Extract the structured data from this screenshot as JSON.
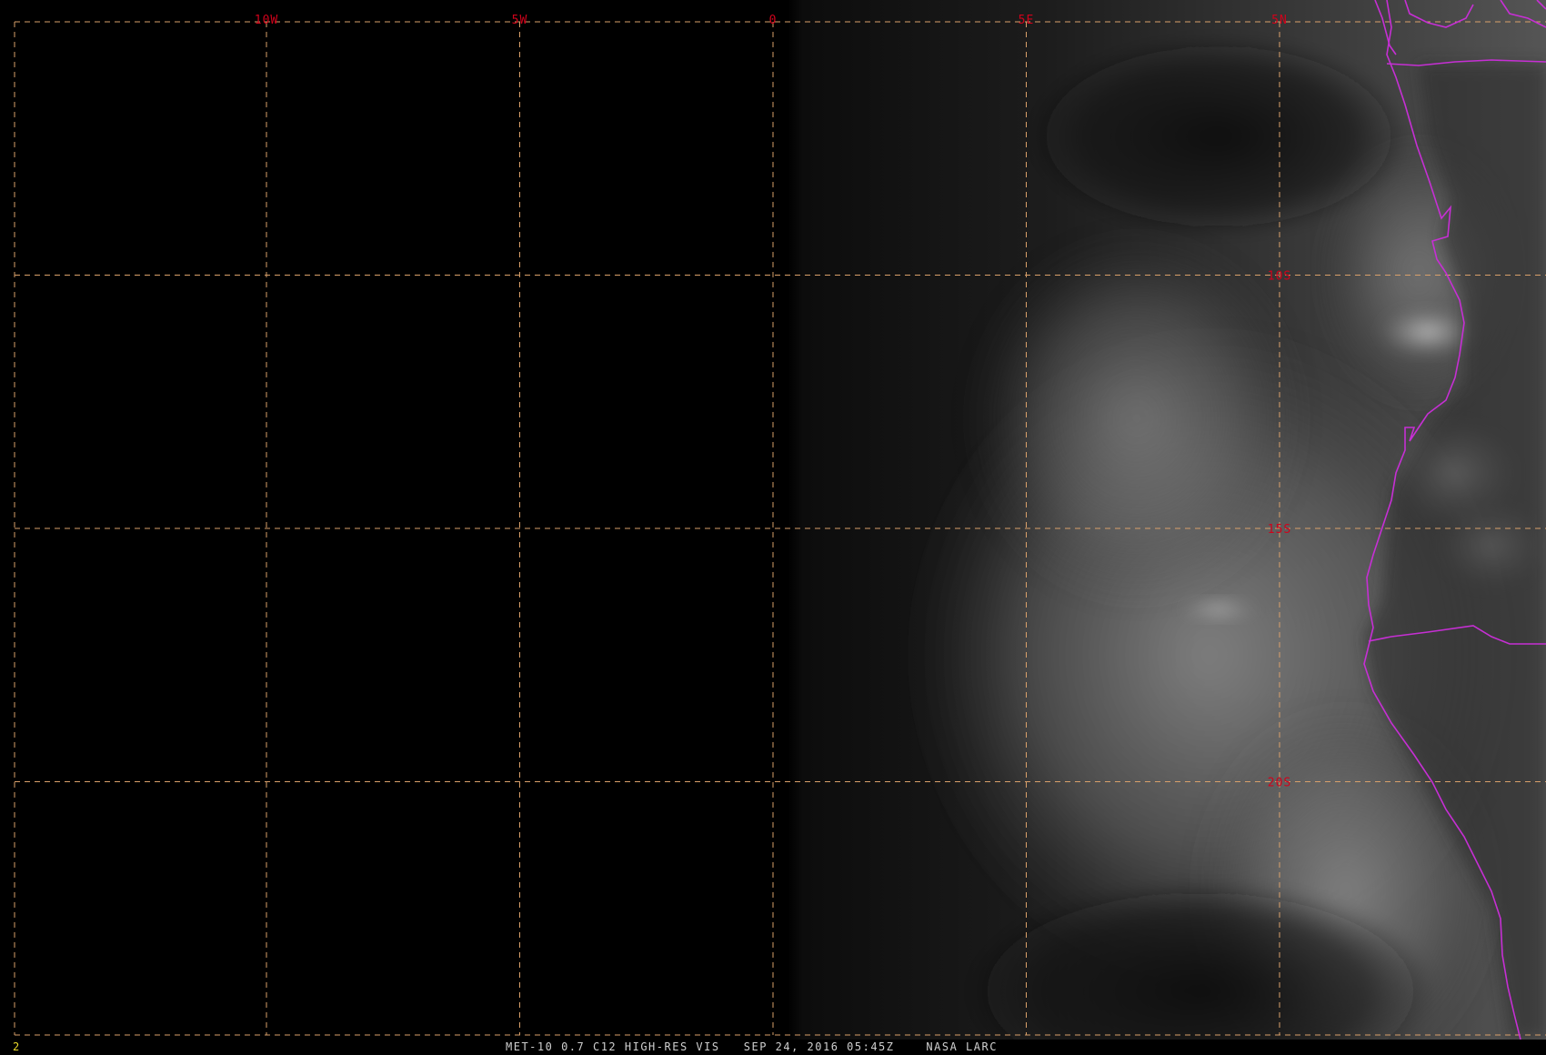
{
  "colors": {
    "background": "#000000",
    "grid": "#d9a06a",
    "grid_label": "#d0021b",
    "border": "#c62fd4",
    "caption": "#cfcfcf",
    "frame_number": "#e8d82a"
  },
  "map": {
    "projection_grid": {
      "longitude_lines": [
        {
          "label": "10W",
          "lon": -10
        },
        {
          "label": "5W",
          "lon": -5
        },
        {
          "label": "0",
          "lon": 0
        },
        {
          "label": "5E",
          "lon": 5
        },
        {
          "label": "5N",
          "lon": 10
        }
      ],
      "latitude_lines": [
        {
          "label": "10S",
          "lat": -10
        },
        {
          "label": "15S",
          "lat": -15
        },
        {
          "label": "20S",
          "lat": -20
        }
      ]
    }
  },
  "status_bar": {
    "frame_number": "2",
    "caption": "MET-10 0.7 C12 HIGH-RES VIS   SEP 24, 2016 05:45Z    NASA LARC"
  }
}
